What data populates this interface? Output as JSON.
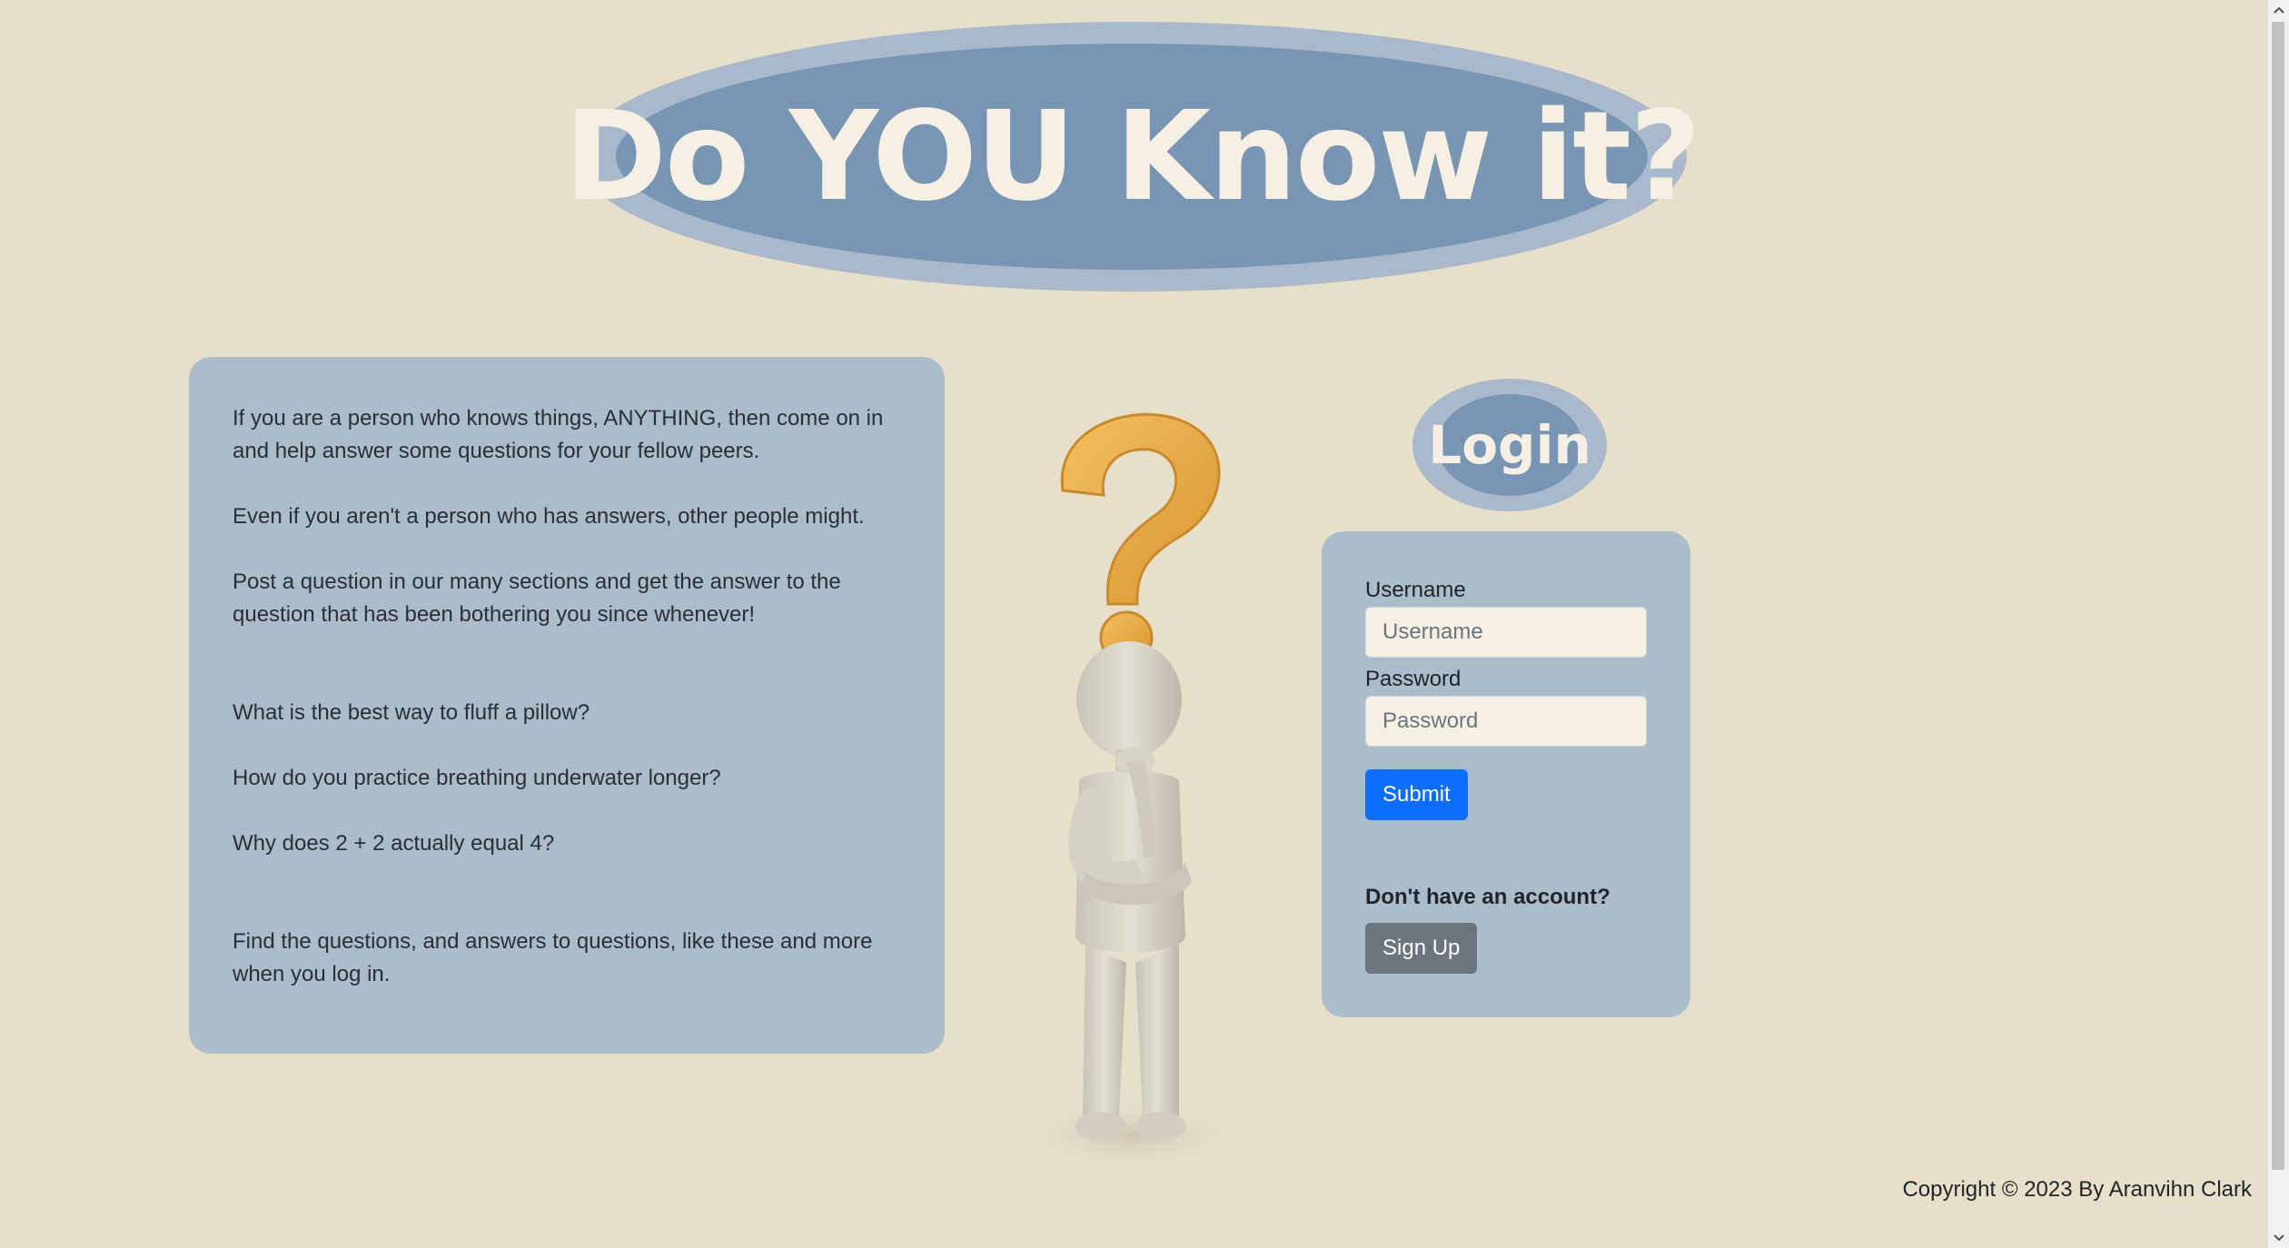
{
  "header": {
    "title": "Do YOU Know it?"
  },
  "info": {
    "paragraphs": [
      "If you are a person who knows things, ANYTHING, then come on in and help answer some questions for your fellow peers.",
      "Even if you aren't a person who has answers, other people might.",
      "Post a question in our many sections and get the answer to the question that has been bothering you since whenever!",
      "What is the best way to fluff a pillow?",
      "How do you practice breathing underwater longer?",
      "Why does 2 + 2 actually equal 4?",
      "Find the questions, and answers to questions, like these and more when you log in."
    ]
  },
  "login": {
    "heading": "Login",
    "username_label": "Username",
    "username_placeholder": "Username",
    "password_label": "Password",
    "password_placeholder": "Password",
    "submit_label": "Submit",
    "signup_prompt": "Don't have an account?",
    "signup_label": "Sign Up"
  },
  "footer": {
    "copyright": "Copyright © 2023 By Aranvihn Clark"
  },
  "colors": {
    "background": "#e7dfca",
    "panel": "#abbccb",
    "oval_outer": "#a9b9cb",
    "oval_inner": "#7896b4",
    "title_text": "#f6efe4",
    "primary_button": "#0d6efd",
    "secondary_button": "#6c757d",
    "question_mark": "#e8a93c"
  },
  "illustration": {
    "icon": "thinking-person-question-mark-icon"
  }
}
